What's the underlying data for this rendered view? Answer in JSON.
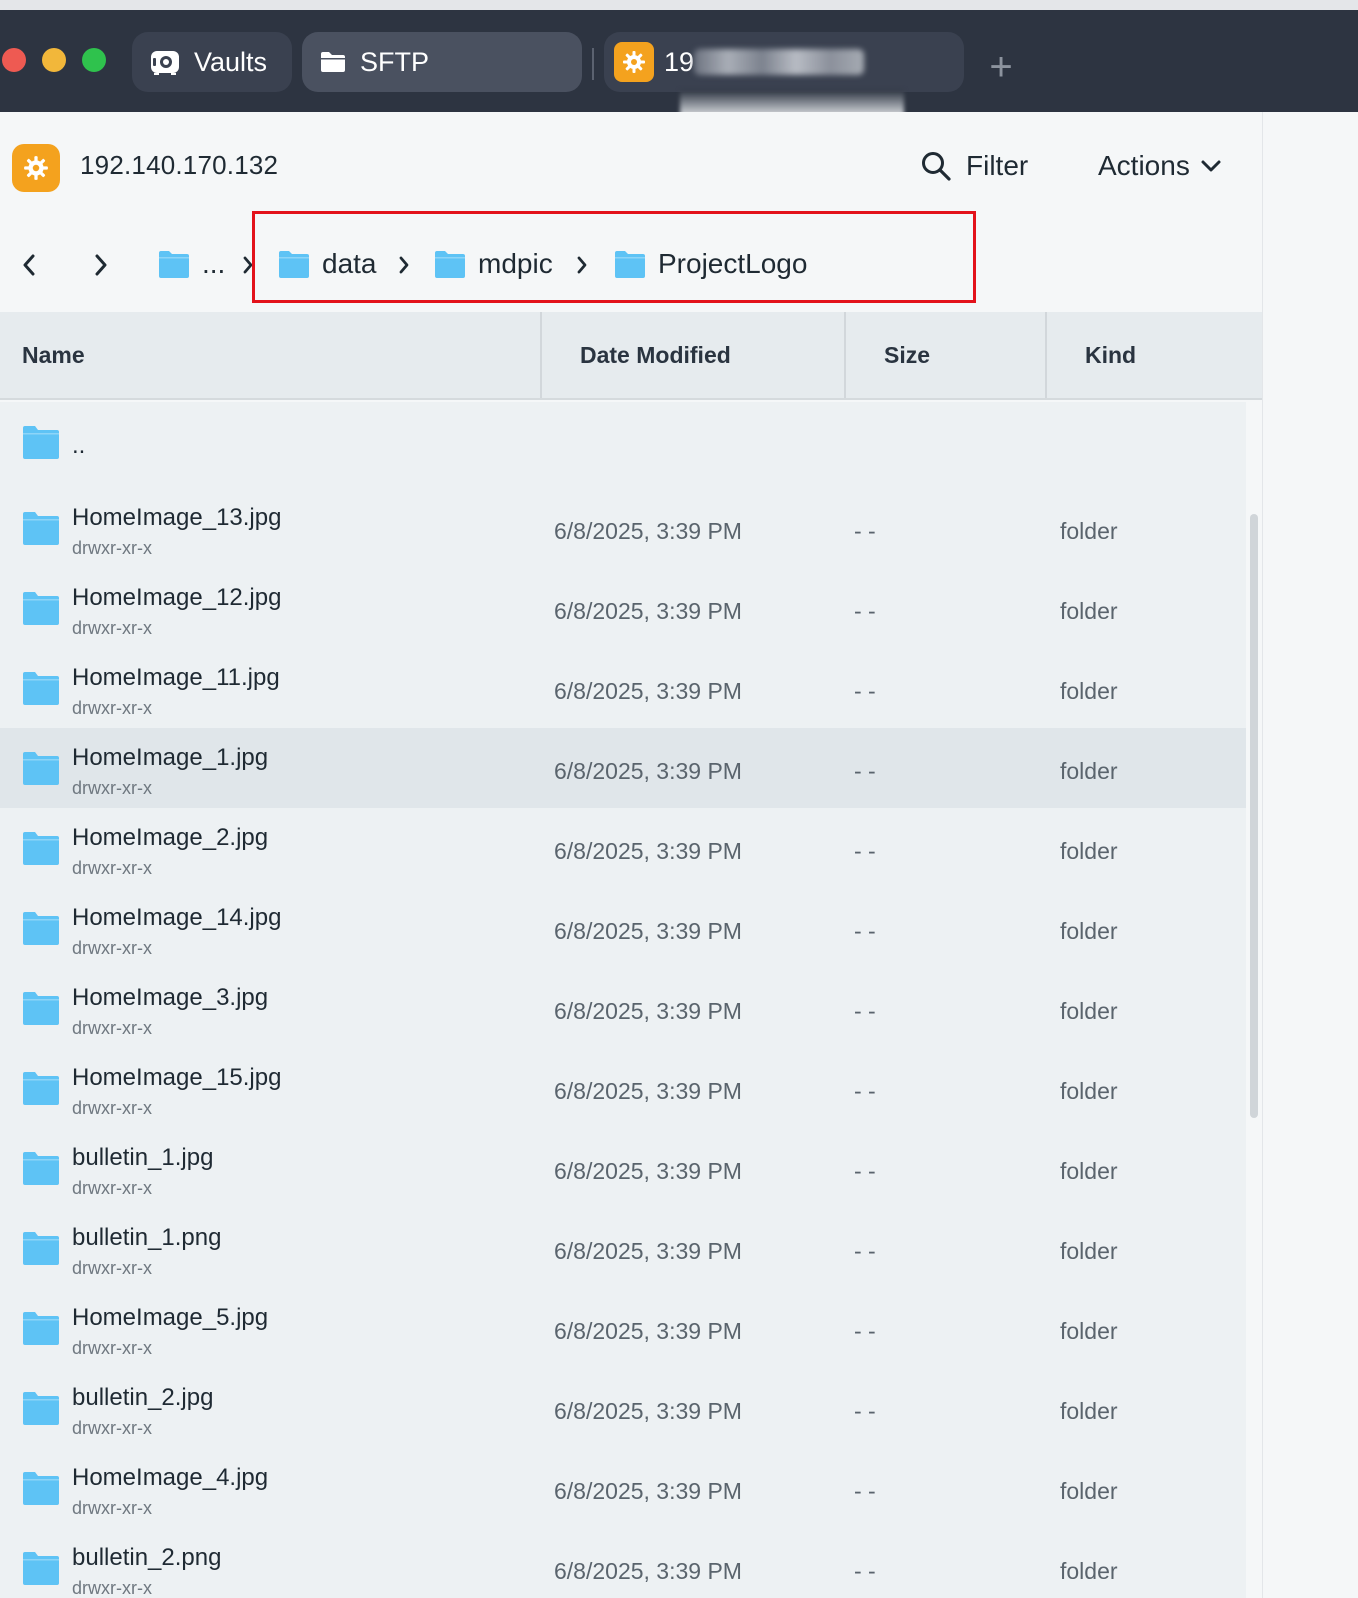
{
  "titlebar": {
    "tabs": [
      {
        "label": "Vaults",
        "icon": "vault-icon"
      },
      {
        "label": "SFTP",
        "icon": "folder-icon"
      },
      {
        "label": "19",
        "icon": "host-gear-icon"
      }
    ],
    "new_tab_label": "+"
  },
  "header": {
    "host": "192.140.170.132",
    "filter_label": "Filter",
    "actions_label": "Actions"
  },
  "breadcrumb": {
    "ellipsis": "...",
    "items": [
      "data",
      "mdpic",
      "ProjectLogo"
    ]
  },
  "table": {
    "columns": [
      "Name",
      "Date Modified",
      "Size",
      "Kind"
    ],
    "parent_label": "..",
    "rows": [
      {
        "name": "HomeImage_13.jpg",
        "perm": "drwxr-xr-x",
        "date": "6/8/2025, 3:39 PM",
        "size": "- -",
        "kind": "folder"
      },
      {
        "name": "HomeImage_12.jpg",
        "perm": "drwxr-xr-x",
        "date": "6/8/2025, 3:39 PM",
        "size": "- -",
        "kind": "folder"
      },
      {
        "name": "HomeImage_11.jpg",
        "perm": "drwxr-xr-x",
        "date": "6/8/2025, 3:39 PM",
        "size": "- -",
        "kind": "folder"
      },
      {
        "name": "HomeImage_1.jpg",
        "perm": "drwxr-xr-x",
        "date": "6/8/2025, 3:39 PM",
        "size": "- -",
        "kind": "folder",
        "selected": true
      },
      {
        "name": "HomeImage_2.jpg",
        "perm": "drwxr-xr-x",
        "date": "6/8/2025, 3:39 PM",
        "size": "- -",
        "kind": "folder"
      },
      {
        "name": "HomeImage_14.jpg",
        "perm": "drwxr-xr-x",
        "date": "6/8/2025, 3:39 PM",
        "size": "- -",
        "kind": "folder"
      },
      {
        "name": "HomeImage_3.jpg",
        "perm": "drwxr-xr-x",
        "date": "6/8/2025, 3:39 PM",
        "size": "- -",
        "kind": "folder"
      },
      {
        "name": "HomeImage_15.jpg",
        "perm": "drwxr-xr-x",
        "date": "6/8/2025, 3:39 PM",
        "size": "- -",
        "kind": "folder"
      },
      {
        "name": "bulletin_1.jpg",
        "perm": "drwxr-xr-x",
        "date": "6/8/2025, 3:39 PM",
        "size": "- -",
        "kind": "folder"
      },
      {
        "name": "bulletin_1.png",
        "perm": "drwxr-xr-x",
        "date": "6/8/2025, 3:39 PM",
        "size": "- -",
        "kind": "folder"
      },
      {
        "name": "HomeImage_5.jpg",
        "perm": "drwxr-xr-x",
        "date": "6/8/2025, 3:39 PM",
        "size": "- -",
        "kind": "folder"
      },
      {
        "name": "bulletin_2.jpg",
        "perm": "drwxr-xr-x",
        "date": "6/8/2025, 3:39 PM",
        "size": "- -",
        "kind": "folder"
      },
      {
        "name": "HomeImage_4.jpg",
        "perm": "drwxr-xr-x",
        "date": "6/8/2025, 3:39 PM",
        "size": "- -",
        "kind": "folder"
      },
      {
        "name": "bulletin_2.png",
        "perm": "drwxr-xr-x",
        "date": "6/8/2025, 3:39 PM",
        "size": "- -",
        "kind": "folder"
      }
    ]
  },
  "colors": {
    "titlebar": "#2d3441",
    "accent_orange": "#f4a21e",
    "folder_blue": "#5ec3f5",
    "highlight_red": "#e3121b"
  }
}
